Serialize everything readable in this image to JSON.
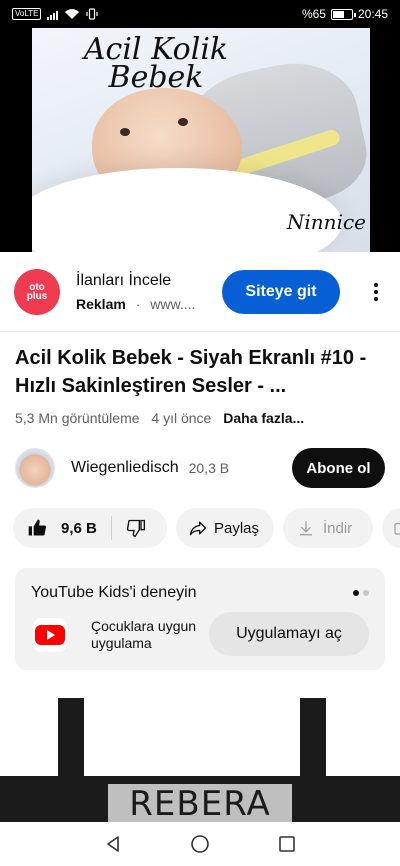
{
  "status_bar": {
    "network_label": "VoLTE",
    "battery_text": "%65",
    "battery_level": 0.65,
    "time": "20:45"
  },
  "video": {
    "thumbnail_title": "Acil Kolik Bebek",
    "thumbnail_subtitle": "Ninnice"
  },
  "ad": {
    "logo_text_top": "oto",
    "logo_text_bottom": "plus",
    "title": "İlanları İncele",
    "label": "Reklam",
    "separator": "·",
    "url": "www....",
    "cta_label": "Siteye git",
    "more_icon": "kebab-menu-icon"
  },
  "video_info": {
    "title": "Acil Kolik Bebek - Siyah Ekranlı #10 - Hızlı Sakinleştiren Sesler - ...",
    "views": "5,3 Mn görüntüleme",
    "age": "4 yıl önce",
    "more_label": "Daha fazla..."
  },
  "channel": {
    "name": "Wiegenliedisch",
    "subscribers": "20,3 B",
    "subscribe_label": "Abone ol"
  },
  "actions": {
    "like_count": "9,6 B",
    "share_label": "Paylaş",
    "download_label": "İndir"
  },
  "kids_card": {
    "title": "YouTube Kids'i deneyin",
    "description": "Çocuklara uygun uygulama",
    "open_label": "Uygulamayı aç",
    "accent": "#ff0000"
  },
  "next_video": {
    "brand_text": "REBERA"
  },
  "colors": {
    "accent_blue": "#065fd4",
    "ad_red": "#ef3b4f"
  }
}
